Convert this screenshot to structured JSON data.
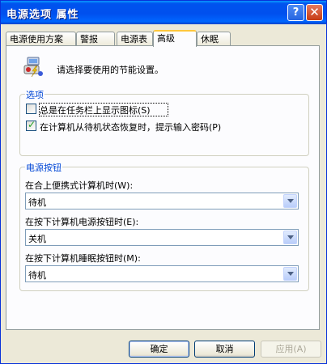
{
  "window": {
    "title": "电源选项 属性",
    "help_glyph": "?",
    "close_glyph": "✕"
  },
  "tabs": [
    {
      "label": "电源使用方案"
    },
    {
      "label": "警报"
    },
    {
      "label": "电源表"
    },
    {
      "label": "高级",
      "active": true
    },
    {
      "label": "休眠"
    }
  ],
  "intro": {
    "text": "请选择要使用的节能设置。",
    "icon": "power-settings-icon"
  },
  "options_group": {
    "title": "选项",
    "items": [
      {
        "label": "总是在任务栏上显示图标(S)",
        "checked": false
      },
      {
        "label": "在计算机从待机状态恢复时，提示输入密码(P)",
        "checked": true
      }
    ]
  },
  "power_buttons_group": {
    "title": "电源按钮",
    "fields": [
      {
        "label": "在合上便携式计算机时(W):",
        "value": "待机"
      },
      {
        "label": "在按下计算机电源按钮时(E):",
        "value": "关机"
      },
      {
        "label": "在按下计算机睡眠按钮时(M):",
        "value": "待机"
      }
    ]
  },
  "buttons": {
    "ok": "确定",
    "cancel": "取消",
    "apply": "应用(A)"
  },
  "colors": {
    "title_bar": "#0053ee",
    "group_title": "#0046d5",
    "check_mark": "#21a121",
    "face": "#ece9d8"
  }
}
